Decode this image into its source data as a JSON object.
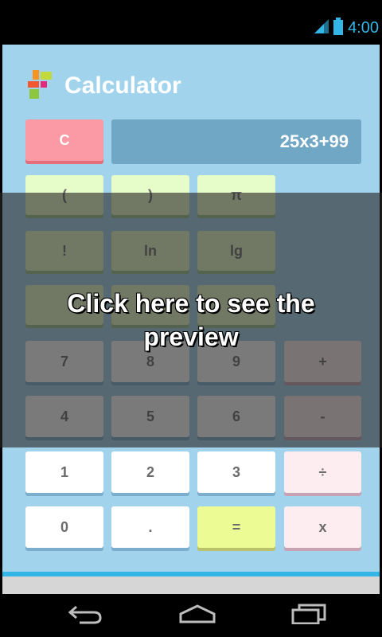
{
  "status_bar": {
    "time": "4:00"
  },
  "app": {
    "title": "Calculator"
  },
  "display": {
    "expression": "25x3+99"
  },
  "buttons": {
    "clear": "C",
    "open_paren": "(",
    "close_paren": ")",
    "pi": "π",
    "factorial": "!",
    "ln": "ln",
    "lg": "lg",
    "seven": "7",
    "eight": "8",
    "nine": "9",
    "plus": "+",
    "four": "4",
    "five": "5",
    "six": "6",
    "minus": "-",
    "one": "1",
    "two": "2",
    "three": "3",
    "divide": "÷",
    "zero": "0",
    "dot": ".",
    "equals": "=",
    "multiply": "x"
  },
  "overlay": {
    "text": "Click here to see the preview"
  },
  "colors": {
    "accent": "#33b5e5",
    "background": "#a1d3ec",
    "clear_button": "#fb9aa4",
    "equals_button": "#ecfb93"
  },
  "icons": {
    "signal": "signal-icon",
    "battery": "battery-icon",
    "back": "back-icon",
    "home": "home-icon",
    "recent": "recent-apps-icon",
    "logo": "calculator-logo-icon"
  }
}
